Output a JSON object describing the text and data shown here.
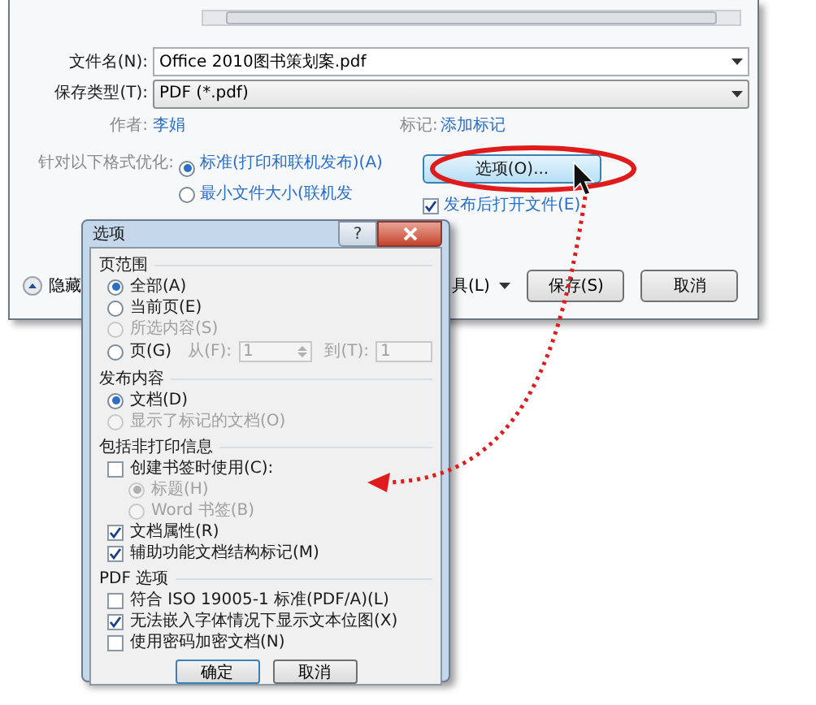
{
  "save_dialog": {
    "file_name": {
      "label": "文件名(N):",
      "value": "Office 2010图书策划案.pdf"
    },
    "save_type": {
      "label": "保存类型(T):",
      "value": "PDF (*.pdf)"
    },
    "author": {
      "label": "作者:",
      "value": "李娟"
    },
    "tags": {
      "label": "标记:",
      "value": "添加标记"
    },
    "optimize": {
      "label": "针对以下格式优化:",
      "options": [
        {
          "label": "标准(打印和联机发布)(A)",
          "selected": true
        },
        {
          "label": "最小文件大小(联机发",
          "selected": false
        }
      ]
    },
    "options_button": "选项(O)...",
    "open_after": {
      "label": "发布后打开文件(E)",
      "checked": true
    },
    "hide_folders": "隐藏",
    "tools": "具(L)",
    "save": "保存(S)",
    "cancel": "取消"
  },
  "options_dialog": {
    "title": "选项",
    "help": "?",
    "sections": [
      {
        "title": "页范围",
        "items": [
          {
            "kind": "radio",
            "label": "全部(A)",
            "selected": true,
            "disabled": false
          },
          {
            "kind": "radio",
            "label": "当前页(E)",
            "selected": false,
            "disabled": false
          },
          {
            "kind": "radio",
            "label": "所选内容(S)",
            "selected": false,
            "disabled": true
          },
          {
            "kind": "range",
            "label": "页(G)",
            "selected": false,
            "disabled": false,
            "from_label": "从(F):",
            "from": "1",
            "to_label": "到(T):",
            "to": "1"
          }
        ]
      },
      {
        "title": "发布内容",
        "items": [
          {
            "kind": "radio",
            "label": "文档(D)",
            "selected": true,
            "disabled": false
          },
          {
            "kind": "radio",
            "label": "显示了标记的文档(O)",
            "selected": false,
            "disabled": true
          }
        ]
      },
      {
        "title": "包括非打印信息",
        "items": [
          {
            "kind": "checkbox",
            "label": "创建书签时使用(C):",
            "checked": false,
            "children": [
              {
                "kind": "radio",
                "label": "标题(H)",
                "selected": true,
                "disabled": true
              },
              {
                "kind": "radio",
                "label": "Word 书签(B)",
                "selected": false,
                "disabled": true
              }
            ]
          },
          {
            "kind": "checkbox",
            "label": "文档属性(R)",
            "checked": true
          },
          {
            "kind": "checkbox",
            "label": "辅助功能文档结构标记(M)",
            "checked": true
          }
        ]
      },
      {
        "title": "PDF 选项",
        "items": [
          {
            "kind": "checkbox",
            "label": "符合 ISO 19005-1 标准(PDF/A)(L)",
            "checked": false
          },
          {
            "kind": "checkbox",
            "label": "无法嵌入字体情况下显示文本位图(X)",
            "checked": true
          },
          {
            "kind": "checkbox",
            "label": "使用密码加密文档(N)",
            "checked": false
          }
        ]
      }
    ],
    "ok": "确定",
    "cancel": "取消"
  }
}
